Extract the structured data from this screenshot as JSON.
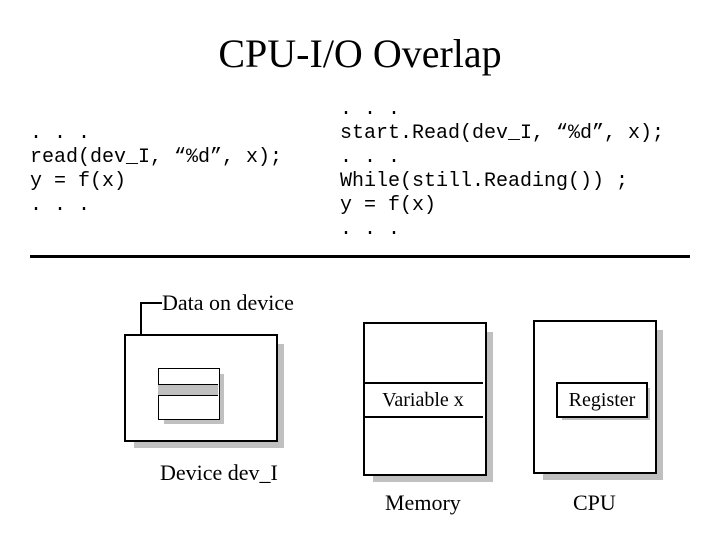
{
  "title": "CPU-I/O Overlap",
  "left_code": ". . .\nread(dev_I, “%d”, x);\ny = f(x)\n. . .",
  "right_code": ". . .\nstart.Read(dev_I, “%d”, x);\n. . .\nWhile(still.Reading()) ;\ny = f(x)\n. . .",
  "labels": {
    "data_on_device": "Data on device",
    "device": "Device dev_I",
    "memory": "Memory",
    "cpu": "CPU",
    "variable_x": "Variable x",
    "register": "Register"
  }
}
